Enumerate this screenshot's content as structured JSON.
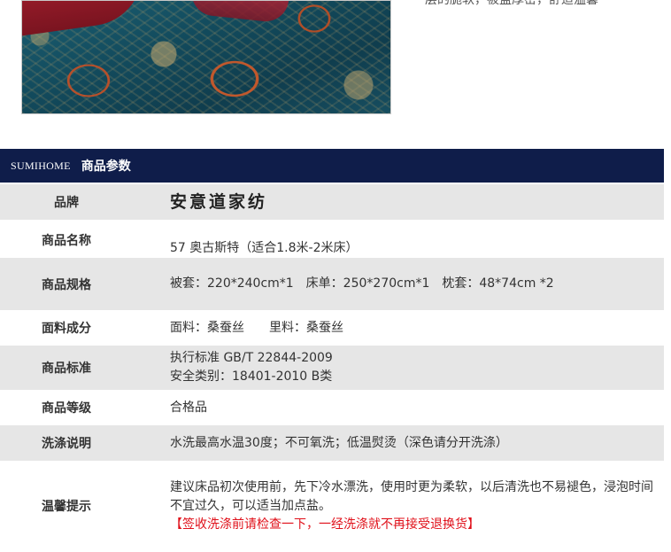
{
  "top_caption": "层的脆软，被盖厚密，舒适温馨",
  "header": {
    "brand_en": "SUMIHOME",
    "title": "商品参数"
  },
  "rows": [
    {
      "label": "品牌",
      "value": "安意道家纺"
    },
    {
      "label": "商品名称",
      "value": "57 奥古斯特（适合1.8米-2米床）"
    },
    {
      "label": "商品规格",
      "value": "被套：220*240cm*1　床单：250*270cm*1　枕套：48*74cm *2"
    },
    {
      "label": "面料成分",
      "value": "面料：桑蚕丝　　里料：桑蚕丝"
    },
    {
      "label": "商品标准",
      "value_line1": "执行标准 GB/T 22844-2009",
      "value_line2": "安全类别：18401-2010 B类"
    },
    {
      "label": "商品等级",
      "value": "合格品"
    },
    {
      "label": "洗涤说明",
      "value": "水洗最高水温30度；不可氧洗；低温熨烫（深色请分开洗涤）"
    },
    {
      "label": "温馨提示",
      "value_line1": "建议床品初次使用前，先下冷水漂洗，使用时更为柔软，以后清洗也不易褪色，浸泡时间",
      "value_line2": "不宜过久，可以适当加点盐。",
      "warning": "【签收洗涤前请检查一下，一经洗涤就不再接受退换货】"
    }
  ],
  "colors": {
    "header_bg": "#0f1d4a",
    "row_gray": "#e6e6e6",
    "warning": "#e0101a"
  }
}
